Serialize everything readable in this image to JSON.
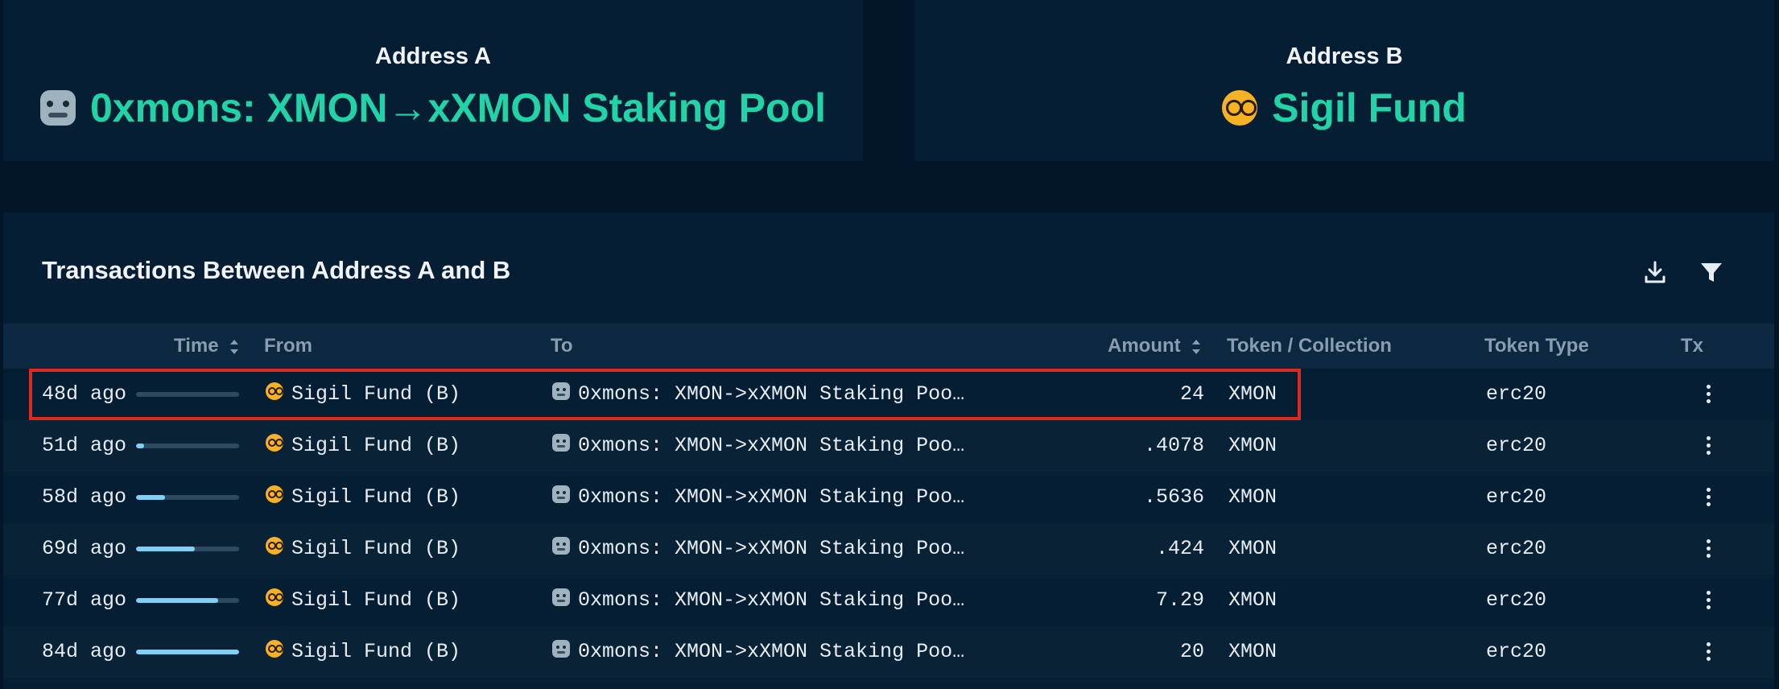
{
  "address_a": {
    "label": "Address A",
    "name": "0xmons: XMON→xXMON Staking Pool",
    "icon": "robot-emoji-icon"
  },
  "address_b": {
    "label": "Address B",
    "name": "Sigil Fund",
    "icon": "nerd-face-emoji-icon"
  },
  "transactions": {
    "title": "Transactions Between Address A and B",
    "columns": {
      "time": "Time",
      "from": "From",
      "to": "To",
      "amount": "Amount",
      "token": "Token / Collection",
      "token_type": "Token Type",
      "tx": "Tx"
    },
    "rows": [
      {
        "time": "48d ago",
        "age_fraction": 0.0,
        "from": "Sigil Fund (B)",
        "to": "0xmons: XMON->xXMON Staking Poo…",
        "amount": "24",
        "token": "XMON",
        "token_type": "erc20"
      },
      {
        "time": "51d ago",
        "age_fraction": 0.08,
        "from": "Sigil Fund (B)",
        "to": "0xmons: XMON->xXMON Staking Poo…",
        "amount": ".4078",
        "token": "XMON",
        "token_type": "erc20"
      },
      {
        "time": "58d ago",
        "age_fraction": 0.28,
        "from": "Sigil Fund (B)",
        "to": "0xmons: XMON->xXMON Staking Poo…",
        "amount": ".5636",
        "token": "XMON",
        "token_type": "erc20"
      },
      {
        "time": "69d ago",
        "age_fraction": 0.57,
        "from": "Sigil Fund (B)",
        "to": "0xmons: XMON->xXMON Staking Poo…",
        "amount": ".424",
        "token": "XMON",
        "token_type": "erc20"
      },
      {
        "time": "77d ago",
        "age_fraction": 0.8,
        "from": "Sigil Fund (B)",
        "to": "0xmons: XMON->xXMON Staking Poo…",
        "amount": "7.29",
        "token": "XMON",
        "token_type": "erc20"
      },
      {
        "time": "84d ago",
        "age_fraction": 1.0,
        "from": "Sigil Fund (B)",
        "to": "0xmons: XMON->xXMON Staking Poo…",
        "amount": "20",
        "token": "XMON",
        "token_type": "erc20"
      }
    ]
  },
  "colors": {
    "accent": "#20d4a8",
    "highlight": "#e0281c",
    "age_bar_fill": "#7fd0f4"
  }
}
